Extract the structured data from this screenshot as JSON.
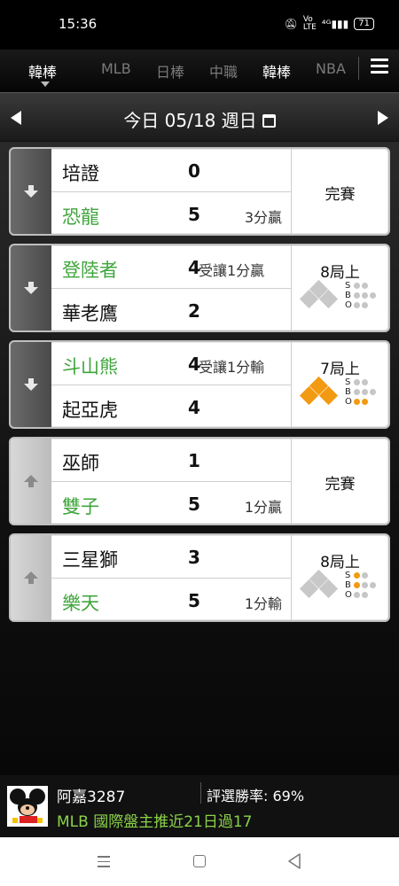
{
  "status_bar": {
    "time": "15:36",
    "icons": [
      "mute-icon",
      "volte-icon",
      "4g-signal-icon"
    ],
    "battery": "71"
  },
  "tabs": [
    {
      "label": "韓棒",
      "active": true
    },
    {
      "label": "MLB",
      "active": false
    },
    {
      "label": "日棒",
      "active": false
    },
    {
      "label": "中職",
      "active": false
    },
    {
      "label": "韓棒",
      "active": false
    },
    {
      "label": "NBA",
      "active": false
    }
  ],
  "date_bar": {
    "label": "今日 05/18 週日"
  },
  "games": [
    {
      "expand": "down",
      "team1": {
        "name": "培證",
        "score": "0",
        "note": "",
        "winner": false
      },
      "team2": {
        "name": "恐龍",
        "score": "5",
        "note": "3分贏",
        "winner": true
      },
      "status": "完賽"
    },
    {
      "expand": "down",
      "team1": {
        "name": "登陸者",
        "score": "4",
        "note": "受讓1分贏",
        "winner": true
      },
      "team2": {
        "name": "華老鷹",
        "score": "2",
        "note": "",
        "winner": false
      },
      "status": "8局上",
      "bases": {
        "first": false,
        "second": false,
        "third": false
      },
      "sbo": {
        "s": 0,
        "b": 0,
        "o": 0
      }
    },
    {
      "expand": "down",
      "team1": {
        "name": "斗山熊",
        "score": "4",
        "note": "受讓1分輸",
        "winner": true
      },
      "team2": {
        "name": "起亞虎",
        "score": "4",
        "note": "",
        "winner": false
      },
      "status": "7局上",
      "bases": {
        "first": true,
        "second": true,
        "third": true
      },
      "sbo": {
        "s": 0,
        "b": 0,
        "o": 2
      }
    },
    {
      "expand": "up",
      "team1": {
        "name": "巫師",
        "score": "1",
        "note": "",
        "winner": false
      },
      "team2": {
        "name": "雙子",
        "score": "5",
        "note": "1分贏",
        "winner": true
      },
      "status": "完賽"
    },
    {
      "expand": "up",
      "team1": {
        "name": "三星獅",
        "score": "3",
        "note": "",
        "winner": false
      },
      "team2": {
        "name": "樂天",
        "score": "5",
        "note": "1分輸",
        "winner": true
      },
      "status": "8局上",
      "bases": {
        "first": false,
        "second": false,
        "third": false
      },
      "sbo": {
        "s": 1,
        "b": 1,
        "o": 0
      }
    }
  ],
  "sbo_labels": [
    "S",
    "B",
    "O"
  ],
  "footer": {
    "username": "阿嘉3287",
    "rate": "評選勝率: 69%",
    "promo": "MLB 國際盤主推近21日過17"
  },
  "colors": {
    "win_green": "#3fa53c",
    "runner_orange": "#f29a12",
    "promo_green": "#8ad24a"
  }
}
